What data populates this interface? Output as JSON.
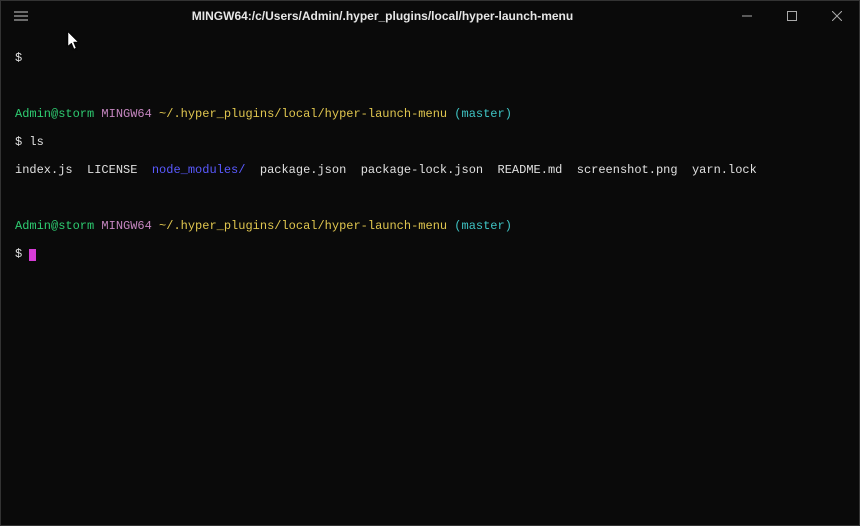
{
  "titlebar": {
    "title": "MINGW64:/c/Users/Admin/.hyper_plugins/local/hyper-launch-menu"
  },
  "prompt": {
    "user": "Admin@storm",
    "system": "MINGW64",
    "path": "~/.hyper_plugins/local/hyper-launch-menu",
    "branch": "(master)"
  },
  "session": {
    "line1_dollar": "$",
    "line2_dollar": "$ ",
    "line2_cmd": "ls",
    "ls_items": [
      {
        "name": "index.js",
        "type": "file"
      },
      {
        "name": "LICENSE",
        "type": "file"
      },
      {
        "name": "node_modules/",
        "type": "dir"
      },
      {
        "name": "package.json",
        "type": "file"
      },
      {
        "name": "package-lock.json",
        "type": "file"
      },
      {
        "name": "README.md",
        "type": "file"
      },
      {
        "name": "screenshot.png",
        "type": "file"
      },
      {
        "name": "yarn.lock",
        "type": "file"
      }
    ],
    "sep": "  ",
    "line4_dollar": "$ "
  },
  "ls_joined": {
    "f0": "index.js",
    "f1": "LICENSE",
    "d2": "node_modules/",
    "f3": "package.json",
    "f4": "package-lock.json",
    "f5": "README.md",
    "f6": "screenshot.png",
    "f7": "yarn.lock"
  }
}
